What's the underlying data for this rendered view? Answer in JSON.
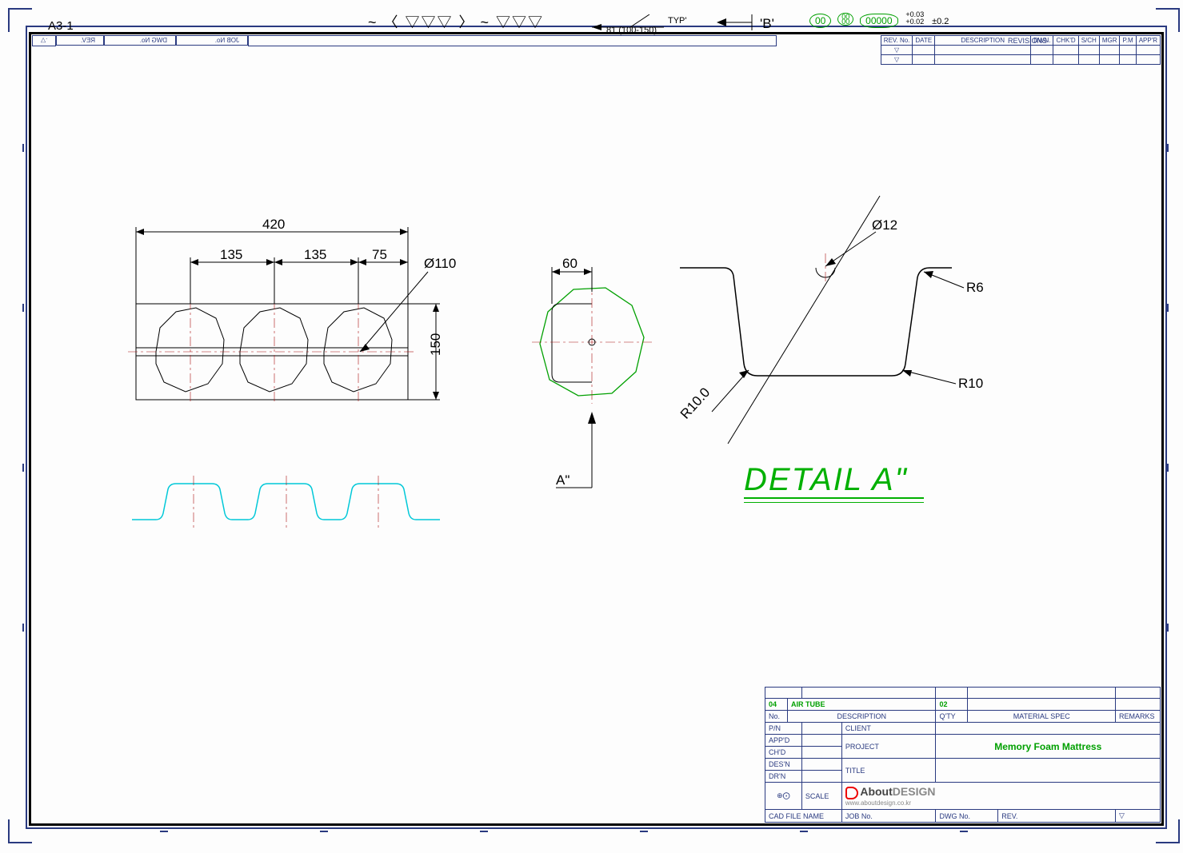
{
  "sheet": {
    "format_label": "A3-1",
    "top_symbols": {
      "wave_group": "~ 〈 ▽▽▽ 〉  ~ ▽▽▽",
      "weld_group": "81 (100-150)",
      "weld_typ": "TYP'",
      "section_arrow": "'B'",
      "badges": [
        "00",
        "00\n00",
        "00000"
      ],
      "tol1": "+0.03\n+0.02",
      "tol2": "±0.2"
    }
  },
  "topleft_cells": [
    "REV.",
    "DWG No.",
    "JOB No."
  ],
  "revisions": {
    "title": "REVISIONS",
    "headers": [
      "REV. No.",
      "DATE",
      "DESCRIPTION",
      "DWN.",
      "CHK'D",
      "S/CH",
      "MGR",
      "P.M",
      "APP'R"
    ]
  },
  "dims": {
    "w_total": "420",
    "p1": "135",
    "p2": "135",
    "p3": "75",
    "dia": "Ø110",
    "h": "150",
    "side_w": "60",
    "det_dia": "Ø12",
    "det_r1": "R6",
    "det_r2": "R10",
    "det_r3": "R10.0",
    "section_label": "A\"",
    "detail_title": "DETAIL A\""
  },
  "title_block": {
    "bom": {
      "no": "04",
      "item": "AIR TUBE",
      "qty": "02",
      "hdr_no": "No.",
      "hdr_desc": "DESCRIPTION",
      "hdr_qty": "Q'TY",
      "hdr_mat": "MATERIAL SPEC",
      "hdr_rem": "REMARKS"
    },
    "rows": {
      "pn": "P/N",
      "appd": "APP'D",
      "chkd": "CH'D",
      "desn": "DES'N",
      "drtn": "DR'N"
    },
    "labels": {
      "client": "CLIENT",
      "project": "PROJECT",
      "title": "TITLE",
      "scale": "SCALE",
      "cad": "CAD FILE NAME",
      "job": "JOB No.",
      "dwg": "DWG No.",
      "rev": "REV."
    },
    "project_value": "Memory Foam Mattress",
    "logo": {
      "brand1": "About",
      "brand2": "DESIGN",
      "url": "www.aboutdesign.co.kr"
    }
  }
}
